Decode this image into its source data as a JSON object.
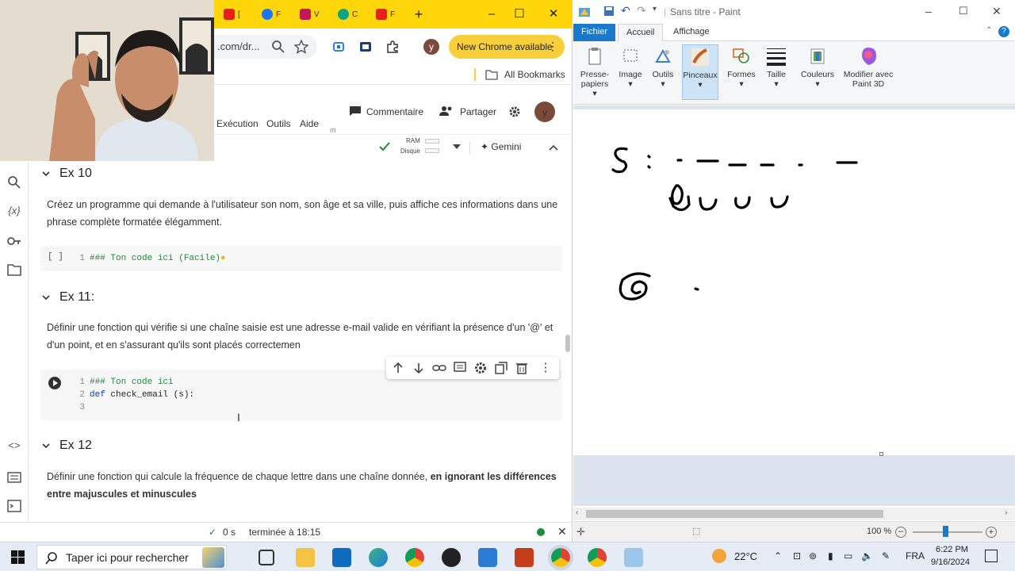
{
  "chrome": {
    "tabs": [
      "[",
      "F",
      "V",
      "C",
      "F"
    ],
    "address_partial": ".com/dr...",
    "new_chrome_label": "New Chrome available",
    "bookmarks_label": "All Bookmarks",
    "profile_letter": "y"
  },
  "colab": {
    "menu": [
      "Exécution",
      "Outils",
      "Aide"
    ],
    "comment_label": "Commentaire",
    "share_label": "Partager",
    "ram_label": "RAM",
    "disk_label": "Disque",
    "gemini_label": "Gemini",
    "sections": [
      {
        "title": "Ex 10",
        "text": "Créez un programme qui demande à l'utilisateur son nom, son âge et sa ville, puis affiche ces informations dans une phrase complète formatée élégamment."
      },
      {
        "title": "Ex 11:",
        "text": "Définir une fonction qui vérifie si une chaîne saisie est une adresse e-mail valide en vérifiant la présence d'un '@' et d'un point, et en s'assurant qu'ils sont placés correctemen"
      },
      {
        "title": "Ex 12",
        "text_plain": "Définir une fonction qui calcule la fréquence de chaque lettre dans une chaîne donnée, ",
        "text_bold": "en ignorant les différences entre majuscules et minuscules"
      }
    ],
    "cell1": {
      "bracket": "[ ]",
      "line_num": "1",
      "code": "### Ton code ici (Facile)"
    },
    "cell2": {
      "lines": [
        {
          "n": "1",
          "code": "### Ton code ici"
        },
        {
          "n": "2",
          "kw": "def",
          "code": " check_email (s):"
        },
        {
          "n": "3",
          "code": ""
        }
      ]
    },
    "status": {
      "check": "✓",
      "duration": "0 s",
      "completed": "terminée à 18:15"
    }
  },
  "paint": {
    "title": "Sans titre - Paint",
    "tabs": [
      "Fichier",
      "Accueil",
      "Affichage"
    ],
    "ribbon": [
      {
        "label": "Presse-papiers"
      },
      {
        "label": "Image"
      },
      {
        "label": "Outils"
      },
      {
        "label": "Pinceaux"
      },
      {
        "label": "Formes"
      },
      {
        "label": "Taille"
      },
      {
        "label": "Couleurs"
      },
      {
        "label": "Modifier avec Paint 3D"
      }
    ],
    "zoom": "100 %"
  },
  "taskbar": {
    "search_placeholder": "Taper ici pour rechercher",
    "weather": "22°C",
    "lang": "FRA",
    "time": "6:22 PM",
    "date": "9/16/2024"
  },
  "colors": {
    "chrome_accent": "#ffd60a",
    "paint_file_tab": "#1979ca",
    "colab_green": "#1a8d3b",
    "keyword_blue": "#0b3fa8"
  }
}
